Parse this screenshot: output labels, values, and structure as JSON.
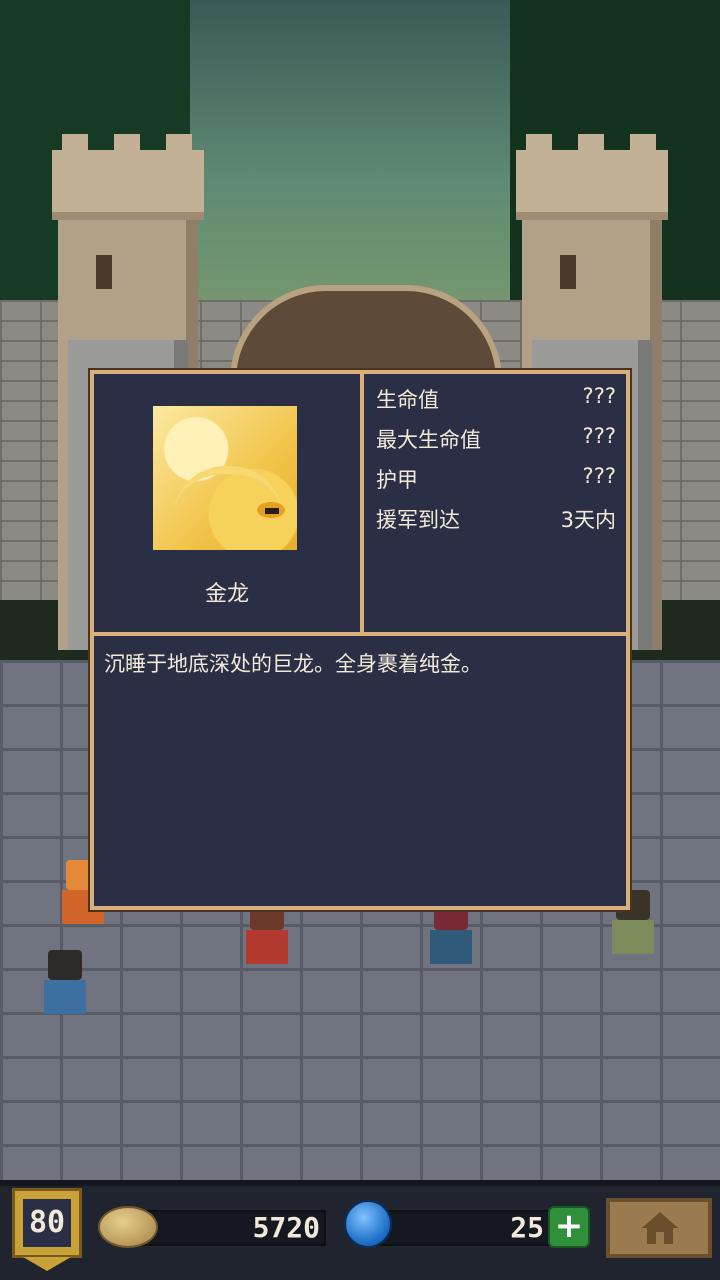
{
  "unit": {
    "name": "金龙",
    "portrait_icon": "golden-dragon-portrait",
    "description": "沉睡于地底深处的巨龙。全身裹着纯金。"
  },
  "stats": [
    {
      "label": "生命值",
      "value": "???"
    },
    {
      "label": "最大生命值",
      "value": "???"
    },
    {
      "label": "护甲",
      "value": "???"
    },
    {
      "label": "援军到达",
      "value": "3天内"
    }
  ],
  "hud": {
    "level": "80",
    "coins": "5720",
    "gems": "25",
    "add_gems_label": "+",
    "icons": {
      "level": "shield-badge-icon",
      "coins": "coin-icon",
      "gems": "gem-icon",
      "home": "home-icon"
    }
  },
  "colors": {
    "panel_bg": "#2b2f45",
    "panel_border": "#d9b07a",
    "text": "#f2ead8",
    "add_button": "#2f8f3a"
  }
}
